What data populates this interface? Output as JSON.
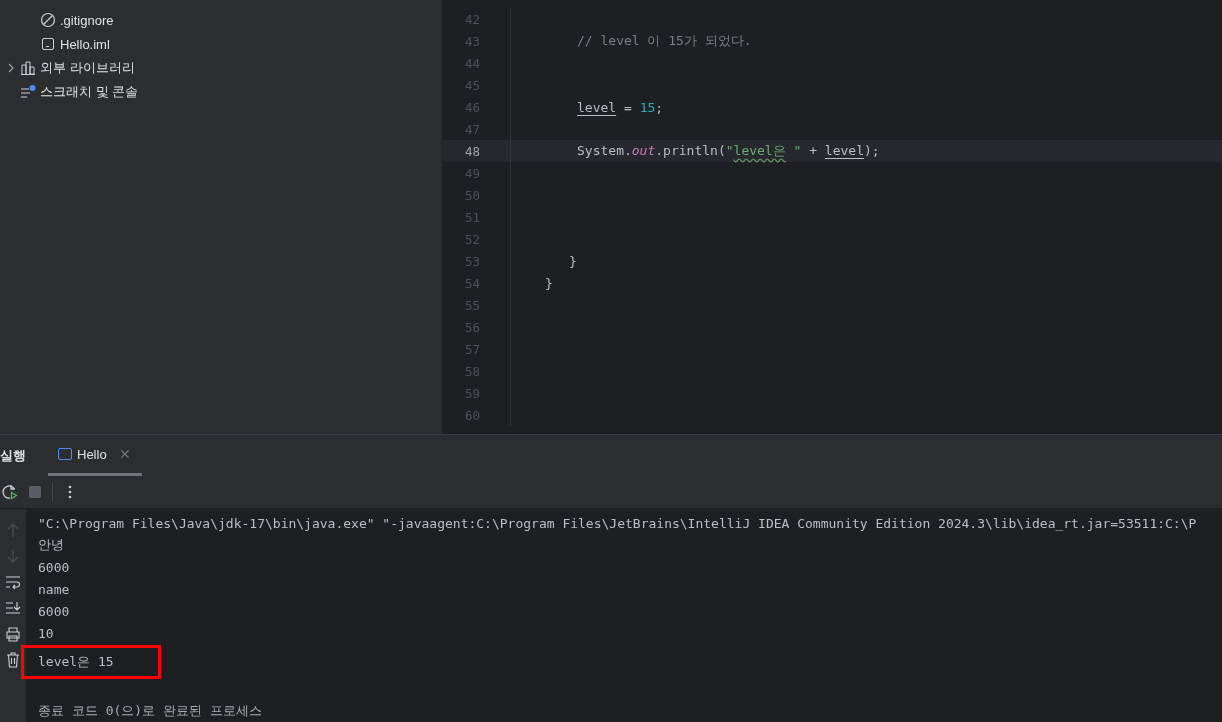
{
  "project_tree": [
    {
      "label": ".gitignore",
      "kind": "ignore"
    },
    {
      "label": "Hello.iml",
      "kind": "module"
    },
    {
      "label": "외부 라이브러리",
      "kind": "library",
      "expanded": false
    },
    {
      "label": "스크래치 및 콘솔",
      "kind": "scratch"
    }
  ],
  "editor": {
    "lines": [
      {
        "number": "42",
        "current": false
      },
      {
        "number": "43",
        "current": false,
        "kind": "statement",
        "tokens": [
          {
            "kind": "comment",
            "text": "// level 이 15가 되었다."
          }
        ]
      },
      {
        "number": "44",
        "current": false
      },
      {
        "number": "45",
        "current": false
      },
      {
        "number": "46",
        "current": false,
        "kind": "statement",
        "tokens": [
          {
            "kind": "variable",
            "text": "level"
          },
          {
            "kind": "plain",
            "text": " = "
          },
          {
            "kind": "number",
            "text": "15"
          },
          {
            "kind": "plain",
            "text": ";"
          }
        ]
      },
      {
        "number": "47",
        "current": false
      },
      {
        "number": "48",
        "current": true,
        "kind": "statement",
        "tokens": [
          {
            "kind": "plain",
            "text": "System."
          },
          {
            "kind": "field",
            "text": "out"
          },
          {
            "kind": "plain",
            "text": ".println("
          },
          {
            "kind": "string",
            "text": "\""
          },
          {
            "kind": "typo",
            "text": "level은"
          },
          {
            "kind": "string",
            "text": " \""
          },
          {
            "kind": "plain",
            "text": " + "
          },
          {
            "kind": "variable",
            "text": "level"
          },
          {
            "kind": "plain",
            "text": ");"
          }
        ]
      },
      {
        "number": "49",
        "current": false
      },
      {
        "number": "50",
        "current": false
      },
      {
        "number": "51",
        "current": false
      },
      {
        "number": "52",
        "current": false
      },
      {
        "number": "53",
        "current": false,
        "kind": "method_end",
        "tokens": [
          {
            "kind": "plain",
            "text": "}"
          }
        ]
      },
      {
        "number": "54",
        "current": false,
        "kind": "class_end",
        "tokens": [
          {
            "kind": "plain",
            "text": "}"
          }
        ]
      },
      {
        "number": "55",
        "current": false
      },
      {
        "number": "56",
        "current": false
      },
      {
        "number": "57",
        "current": false
      },
      {
        "number": "58",
        "current": false
      },
      {
        "number": "59",
        "current": false
      },
      {
        "number": "60",
        "current": false
      }
    ]
  },
  "run_panel": {
    "title": "실행",
    "tabs": [
      {
        "label": "Hello",
        "selected": true
      }
    ],
    "console": [
      {
        "text": "\"C:\\Program Files\\Java\\jdk-17\\bin\\java.exe\" \"-javaagent:C:\\Program Files\\JetBrains\\IntelliJ IDEA Community Edition 2024.3\\lib\\idea_rt.jar=53511:C:\\P",
        "kind": "command",
        "highlighted": false
      },
      {
        "text": "안녕",
        "kind": "output",
        "highlighted": false
      },
      {
        "text": "6000",
        "kind": "output",
        "highlighted": false
      },
      {
        "text": "name",
        "kind": "output",
        "highlighted": false
      },
      {
        "text": "6000",
        "kind": "output",
        "highlighted": false
      },
      {
        "text": "10",
        "kind": "output",
        "highlighted": false
      },
      {
        "text": "level은 15",
        "kind": "output",
        "highlighted": true
      },
      {
        "text": "종료 코드 0(으)로 완료된 프로세스",
        "kind": "system",
        "highlighted": false
      }
    ]
  }
}
